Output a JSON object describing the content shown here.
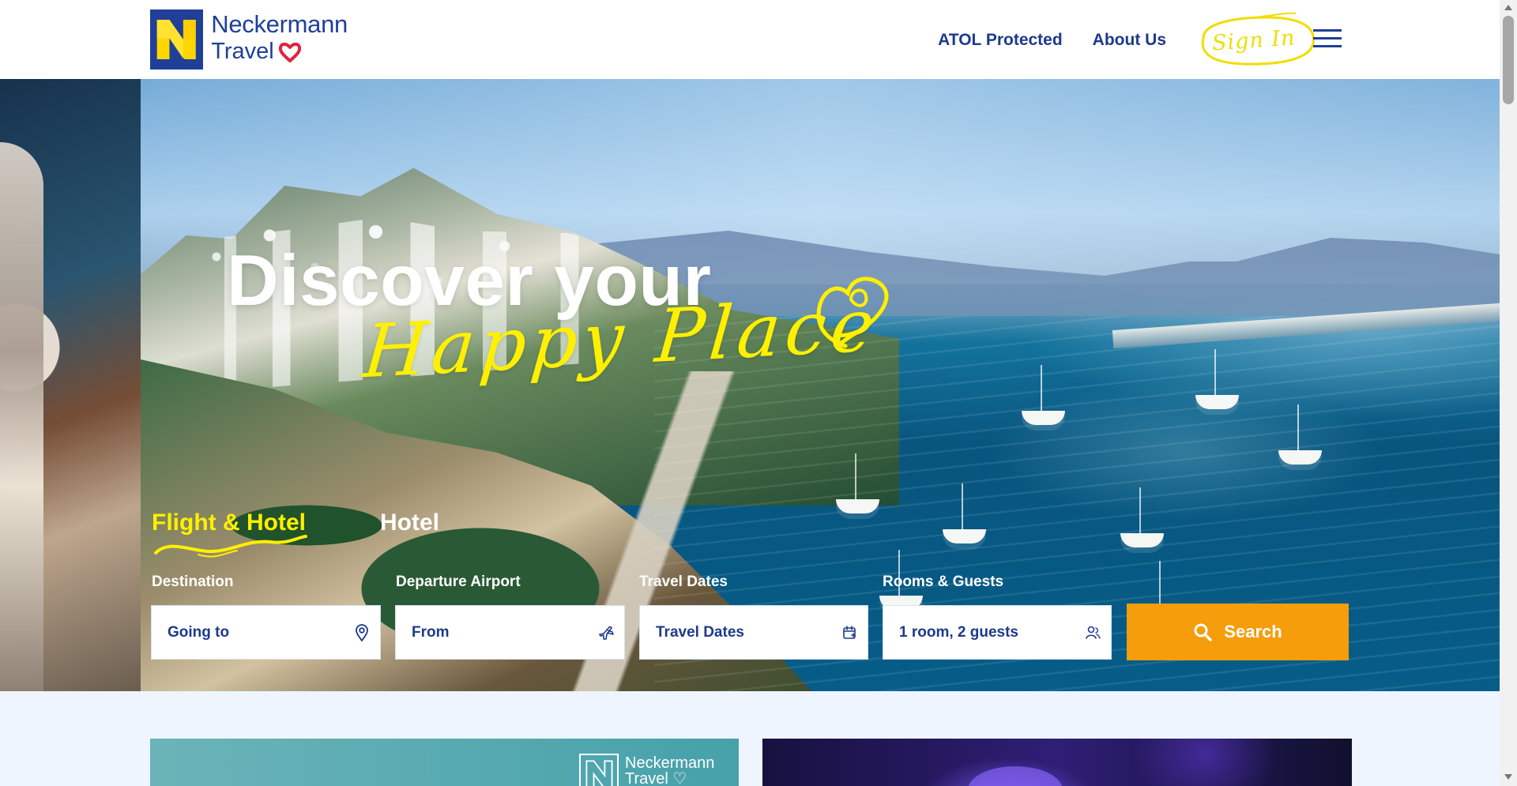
{
  "header": {
    "brand_top": "Neckermann",
    "brand_bottom": "Travel",
    "nav": {
      "atol": "ATOL Protected",
      "about": "About Us",
      "sign_in": "Sign In"
    }
  },
  "hero": {
    "title": "Discover your",
    "script": "Happy Place"
  },
  "search": {
    "tabs": [
      {
        "label": "Flight & Hotel",
        "selected": true
      },
      {
        "label": "Hotel",
        "selected": false
      }
    ],
    "fields": {
      "destination": {
        "label": "Destination",
        "value": "Going to",
        "icon": "location-pin-icon"
      },
      "departure": {
        "label": "Departure Airport",
        "value": "From",
        "icon": "plane-icon"
      },
      "dates": {
        "label": "Travel Dates",
        "value": "Travel Dates",
        "icon": "calendar-icon"
      },
      "rooms": {
        "label": "Rooms & Guests",
        "value": "1 room, 2 guests",
        "icon": "guests-icon"
      }
    },
    "button": "Search"
  },
  "lower": {
    "brand_top": "Neckermann",
    "brand_bottom": "Travel"
  },
  "colors": {
    "brand_blue": "#1d3a8c",
    "accent_yellow": "#fff000",
    "search_orange": "#f59d0b"
  }
}
